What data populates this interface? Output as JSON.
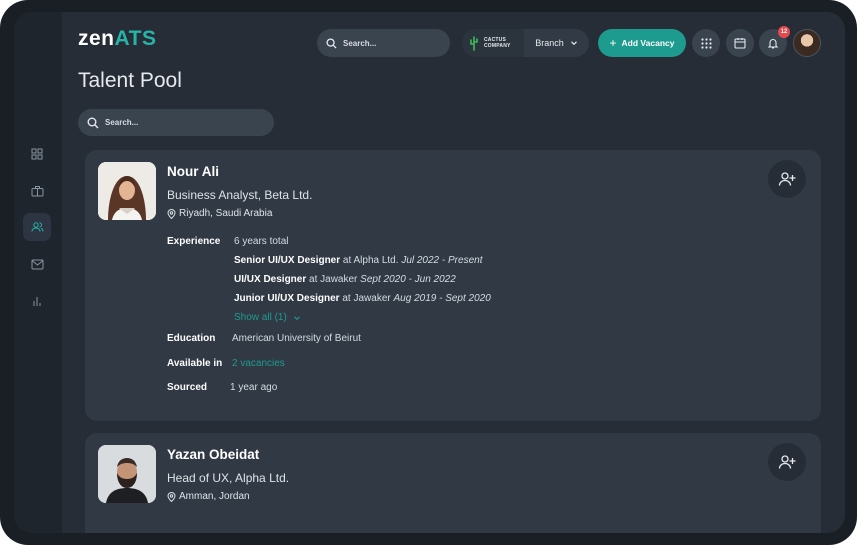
{
  "app": {
    "logo_main": "zen",
    "logo_accent": "ATS"
  },
  "header": {
    "search_placeholder": "Search...",
    "company_name_line1": "CACTUS",
    "company_name_line2": "COMPANY",
    "branch_label": "Branch",
    "add_vacancy_label": "Add Vacancy",
    "notification_count": "12"
  },
  "page": {
    "title": "Talent Pool",
    "search_placeholder": "Search..."
  },
  "candidates": [
    {
      "name": "Nour Ali",
      "role": "Business Analyst, Beta Ltd.",
      "location": "Riyadh, Saudi Arabia",
      "experience_label": "Experience",
      "experience_total": "6 years total",
      "experience": [
        {
          "title": "Senior UI/UX Designer",
          "at": "at Alpha Ltd.",
          "dates": "Jul 2022 - Present"
        },
        {
          "title": "UI/UX Designer",
          "at": "at Jawaker",
          "dates": "Sept 2020 - Jun 2022"
        },
        {
          "title": "Junior UI/UX Designer",
          "at": "at Jawaker",
          "dates": "Aug 2019 - Sept 2020"
        }
      ],
      "show_all": "Show all (1)",
      "education_label": "Education",
      "education": "American University of Beirut",
      "available_label": "Available in",
      "available": "2 vacancies",
      "sourced_label": "Sourced",
      "sourced": "1 year ago"
    },
    {
      "name": "Yazan Obeidat",
      "role": "Head of UX, Alpha Ltd.",
      "location": "Amman, Jordan"
    }
  ],
  "colors": {
    "accent": "#1e9b8f",
    "background": "#262d36",
    "card": "#303944",
    "badge": "#e5484d"
  },
  "icons": {
    "sidebar": [
      "dashboard-icon",
      "briefcase-icon",
      "users-icon",
      "mail-icon",
      "bar-chart-icon"
    ],
    "header": [
      "search-icon",
      "cactus-logo-icon",
      "chevron-down-icon",
      "plus-icon",
      "apps-grid-icon",
      "calendar-icon",
      "bell-icon"
    ],
    "card": [
      "location-pin-icon",
      "add-user-icon"
    ]
  }
}
